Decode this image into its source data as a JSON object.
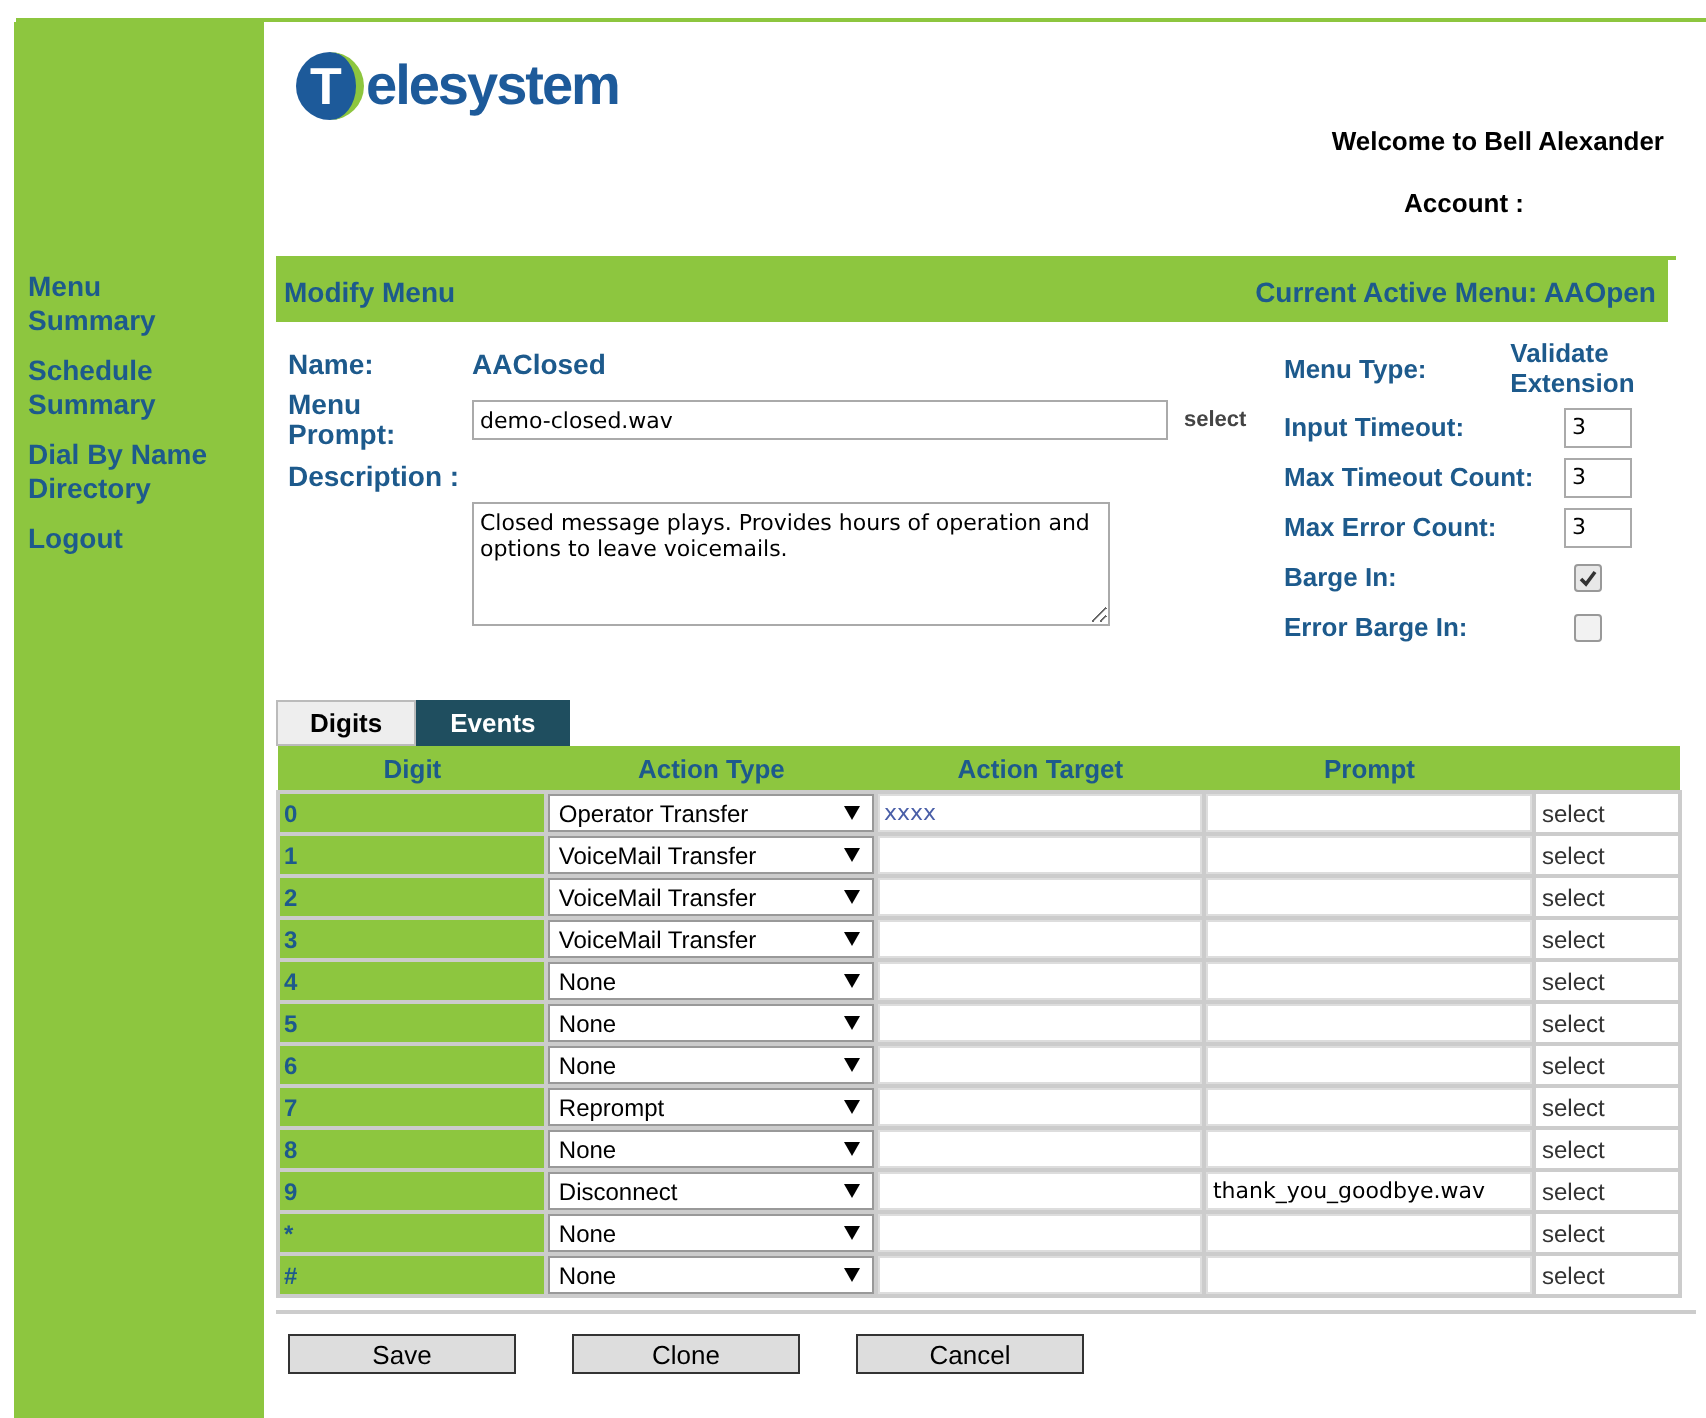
{
  "sidebar": {
    "items": [
      {
        "label": "Menu Summary"
      },
      {
        "label": "Schedule Summary"
      },
      {
        "label": "Dial By Name Directory"
      },
      {
        "label": "Logout"
      }
    ]
  },
  "header": {
    "logo_mark": "T",
    "logo_text": "elesystem",
    "welcome": "Welcome to Bell Alexander",
    "account_label": "Account :"
  },
  "panel": {
    "title": "Modify Menu",
    "active_menu": "Current Active Menu: AAOpen"
  },
  "form": {
    "name_label": "Name:",
    "name_value": "AAClosed",
    "prompt_label": "Menu Prompt:",
    "prompt_value": "demo-closed.wav",
    "prompt_select": "select",
    "description_label": "Description :",
    "description_value": "Closed message plays. Provides hours of operation and options to leave voicemails.",
    "settings": [
      {
        "kind": "text",
        "label": "Menu Type:",
        "value": "Validate Extension"
      },
      {
        "kind": "number",
        "label": "Input Timeout:",
        "value": "3"
      },
      {
        "kind": "number",
        "label": "Max Timeout Count:",
        "value": "3"
      },
      {
        "kind": "number",
        "label": "Max Error Count:",
        "value": "3"
      },
      {
        "kind": "checkbox",
        "label": "Barge In:",
        "checked": true
      },
      {
        "kind": "checkbox",
        "label": "Error Barge In:",
        "checked": false
      }
    ]
  },
  "tabs": [
    {
      "label": "Digits",
      "selected": false
    },
    {
      "label": "Events",
      "selected": true
    }
  ],
  "table": {
    "columns": [
      "Digit",
      "Action Type",
      "Action Target",
      "Prompt"
    ],
    "rows": [
      {
        "digit": "0",
        "action": "Operator Transfer",
        "target": "xxxx",
        "select": "select"
      },
      {
        "digit": "1",
        "action": "VoiceMail Transfer",
        "select": "select"
      },
      {
        "digit": "2",
        "action": "VoiceMail Transfer",
        "select": "select"
      },
      {
        "digit": "3",
        "action": "VoiceMail Transfer",
        "select": "select"
      },
      {
        "digit": "4",
        "action": "None",
        "select": "select"
      },
      {
        "digit": "5",
        "action": "None",
        "select": "select"
      },
      {
        "digit": "6",
        "action": "None",
        "select": "select"
      },
      {
        "digit": "7",
        "action": "Reprompt",
        "select": "select"
      },
      {
        "digit": "8",
        "action": "None",
        "select": "select"
      },
      {
        "digit": "9",
        "action": "Disconnect",
        "prompt": "thank_you_goodbye.wav",
        "select": "select"
      },
      {
        "digit": "*",
        "action": "None",
        "select": "select"
      },
      {
        "digit": "#",
        "action": "None",
        "select": "select"
      }
    ]
  },
  "buttons": [
    "Save",
    "Clone",
    "Cancel"
  ]
}
